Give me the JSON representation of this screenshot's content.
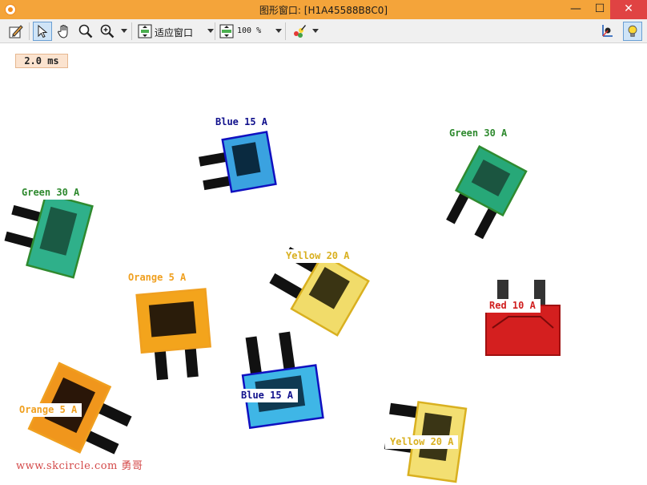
{
  "window": {
    "title": "图形窗口: [H1A45588B8C0]",
    "minimize_glyph": "—",
    "maximize_glyph": "☐",
    "close_glyph": "✕"
  },
  "toolbar": {
    "fit_mode_label": "适应窗口",
    "zoom_value": "100 %",
    "icons": [
      "edit-icon",
      "pointer-icon",
      "hand-pan-icon",
      "magnifier-icon",
      "zoom-in-icon",
      "fit-window-icon",
      "zoom-percent-icon",
      "color-brush-icon",
      "axis-icon",
      "lightbulb-icon"
    ]
  },
  "canvas": {
    "timing": "2.0 ms",
    "watermark": "www.skcircle.com 勇哥",
    "results": [
      {
        "text": "Blue 15 A",
        "color": "#10108c"
      },
      {
        "text": "Green 30 A",
        "color": "#2f8a2f"
      },
      {
        "text": "Green 30 A",
        "color": "#2f8a2f"
      },
      {
        "text": "Yellow 20 A",
        "color": "#d9b020"
      },
      {
        "text": "Orange 5 A",
        "color": "#f0a020"
      },
      {
        "text": "Red 10 A",
        "color": "#d02020"
      },
      {
        "text": "Blue 15 A",
        "color": "#10108c"
      },
      {
        "text": "Orange 5 A",
        "color": "#f0a020"
      },
      {
        "text": "Yellow 20 A",
        "color": "#d9b020"
      }
    ]
  }
}
